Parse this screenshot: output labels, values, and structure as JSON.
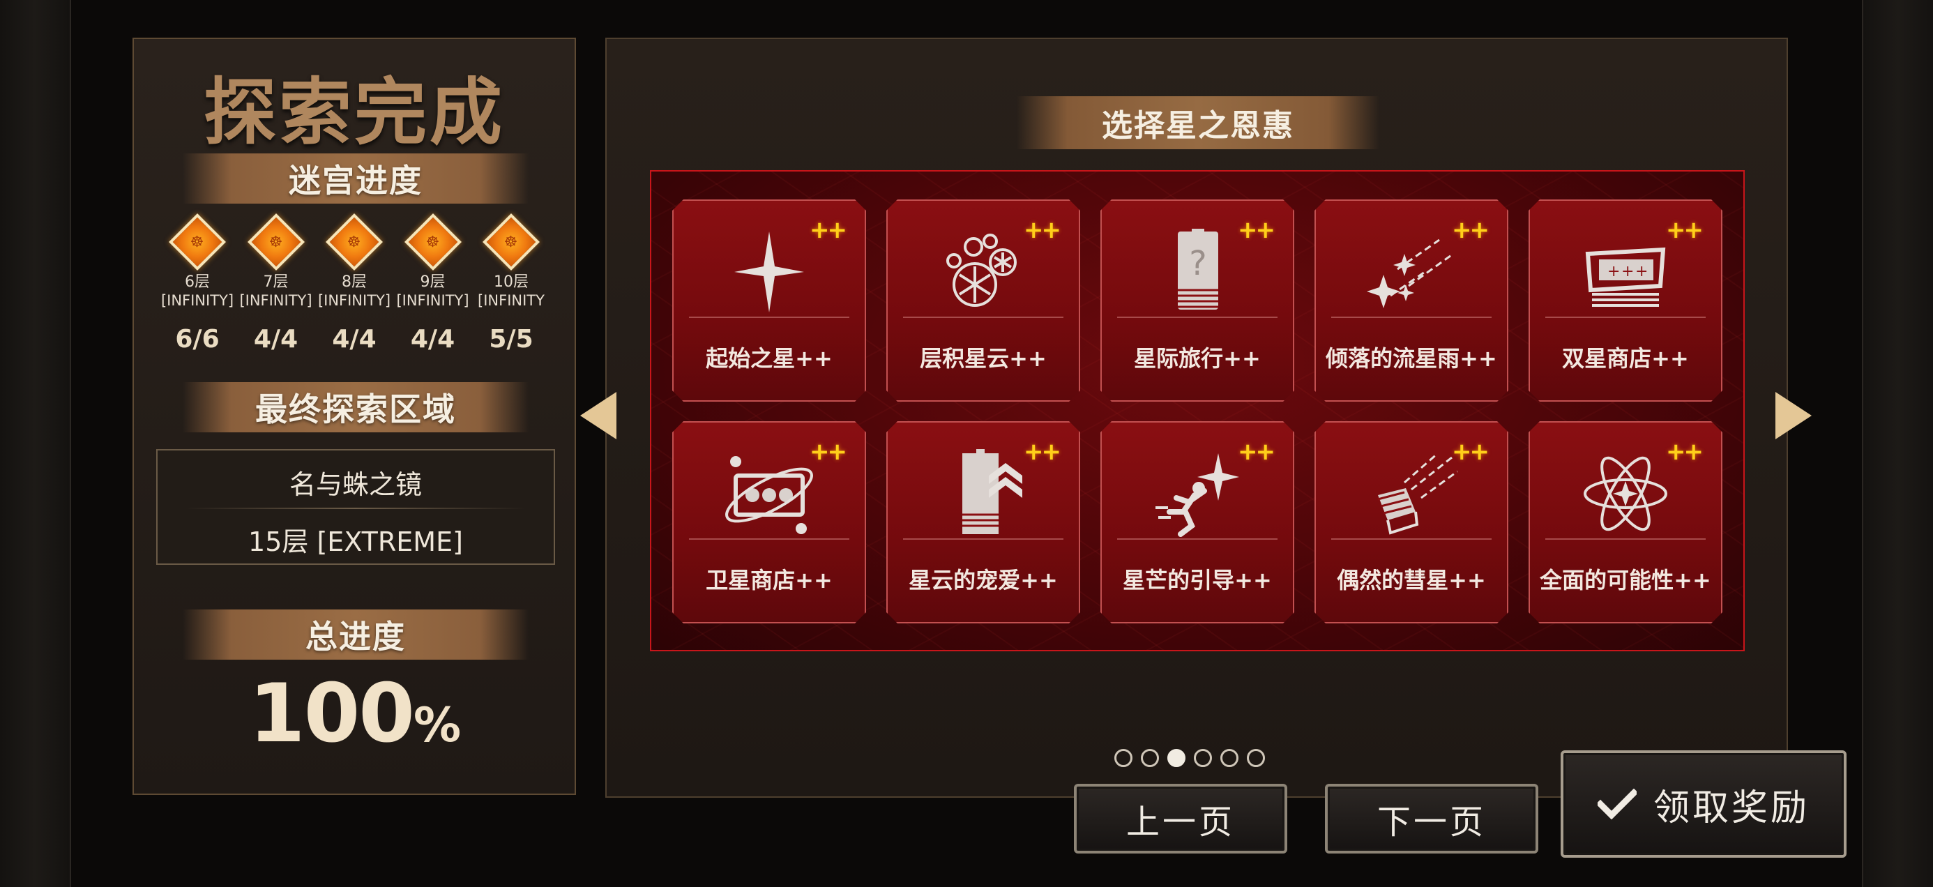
{
  "left_panel": {
    "title": "探索完成",
    "labyrinth_progress_label": "迷宫进度",
    "floors": [
      {
        "badge": "☸",
        "floor": "6层",
        "difficulty": "[INFINITY]",
        "count": "6/6"
      },
      {
        "badge": "☸",
        "floor": "7层",
        "difficulty": "[INFINITY]",
        "count": "4/4"
      },
      {
        "badge": "☸",
        "floor": "8层",
        "difficulty": "[INFINITY]",
        "count": "4/4"
      },
      {
        "badge": "☸",
        "floor": "9层",
        "difficulty": "[INFINITY]",
        "count": "4/4"
      },
      {
        "badge": "☸",
        "floor": "10层",
        "difficulty": "[INFINITY",
        "count": "5/5"
      }
    ],
    "final_area_label": "最终探索区域",
    "final_area_name": "名与蛛之镜",
    "final_area_level": "15层 [EXTREME]",
    "total_progress_label": "总进度",
    "total_progress_number": "100",
    "total_progress_unit": "%"
  },
  "right_panel": {
    "title": "选择星之恩惠",
    "cards": [
      {
        "label": "起始之星++",
        "plus": "++",
        "icon": "four-point-star-icon"
      },
      {
        "label": "层积星云++",
        "plus": "++",
        "icon": "snowflake-cluster-icon"
      },
      {
        "label": "星际旅行++",
        "plus": "++",
        "icon": "mystery-card-icon"
      },
      {
        "label": "倾落的流星雨++",
        "plus": "++",
        "icon": "meteor-shower-icon"
      },
      {
        "label": "双星商店++",
        "plus": "++",
        "icon": "shop-icon"
      },
      {
        "label": "卫星商店++",
        "plus": "++",
        "icon": "orbit-shop-icon"
      },
      {
        "label": "星云的宠爱++",
        "plus": "++",
        "icon": "tag-chevron-icon"
      },
      {
        "label": "星芒的引导++",
        "plus": "++",
        "icon": "running-figure-icon"
      },
      {
        "label": "偶然的彗星++",
        "plus": "++",
        "icon": "comet-box-icon"
      },
      {
        "label": "全面的可能性++",
        "plus": "++",
        "icon": "atom-icon"
      }
    ],
    "pagination": {
      "total": 6,
      "current": 3
    }
  },
  "buttons": {
    "prev": "上一页",
    "next": "下一页",
    "claim": "领取奖励"
  },
  "colors": {
    "accent_gold": "#e4c796",
    "card_red": "#8a0f12",
    "plus_yellow": "#ffcf1a",
    "frame_red": "#c8151a"
  }
}
